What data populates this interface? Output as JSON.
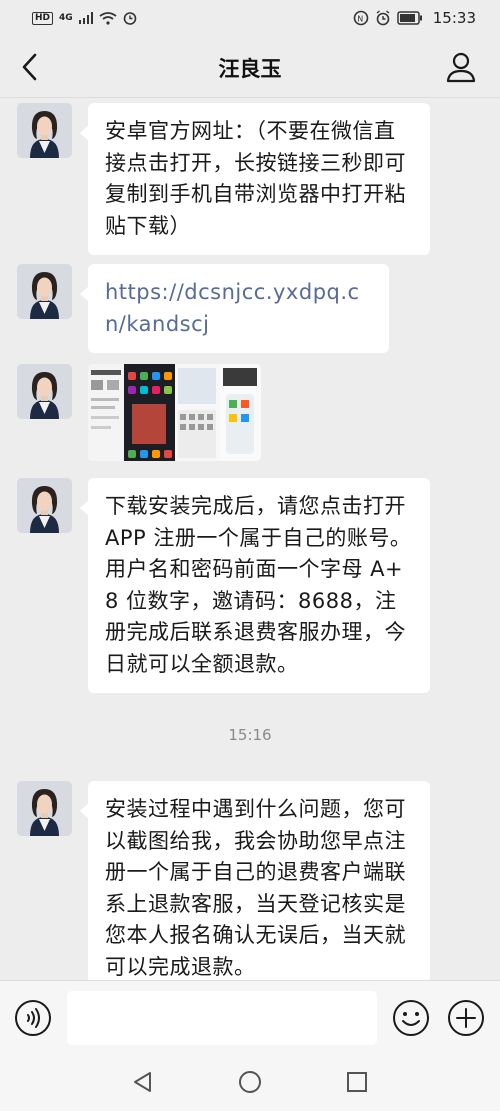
{
  "status_bar": {
    "hd": "HD",
    "network": "4G",
    "time": "15:33"
  },
  "header": {
    "title": "汪良玉"
  },
  "messages": [
    {
      "type": "text",
      "text": "安卓官方网址：（不要在微信直接点击打开，长按链接三秒即可复制到手机自带浏览器中打开粘贴下载）"
    },
    {
      "type": "link",
      "text": "https://dcsnjcc.yxdpq.cn/kandscj"
    },
    {
      "type": "image"
    },
    {
      "type": "text",
      "text": "下载安装完成后，请您点击打开 APP 注册一个属于自己的账号。用户名和密码前面一个字母 A+8 位数字，邀请码：8688，注册完成后联系退费客服办理，今日就可以全额退款。"
    },
    {
      "type": "text",
      "text": "安装过程中遇到什么问题，您可以截图给我，我会协助您早点注册一个属于自己的退费客户端联系上退款客服，当天登记核实是您本人报名确认无误后，当天就可以完成退款。"
    }
  ],
  "timestamp": "15:16",
  "icons": {
    "back": "chevron-left-icon",
    "profile": "person-icon",
    "voice": "voice-icon",
    "emoji": "emoji-icon",
    "plus": "plus-icon"
  },
  "colors": {
    "background": "#ededed",
    "bubble": "#ffffff",
    "link": "#576b95"
  }
}
